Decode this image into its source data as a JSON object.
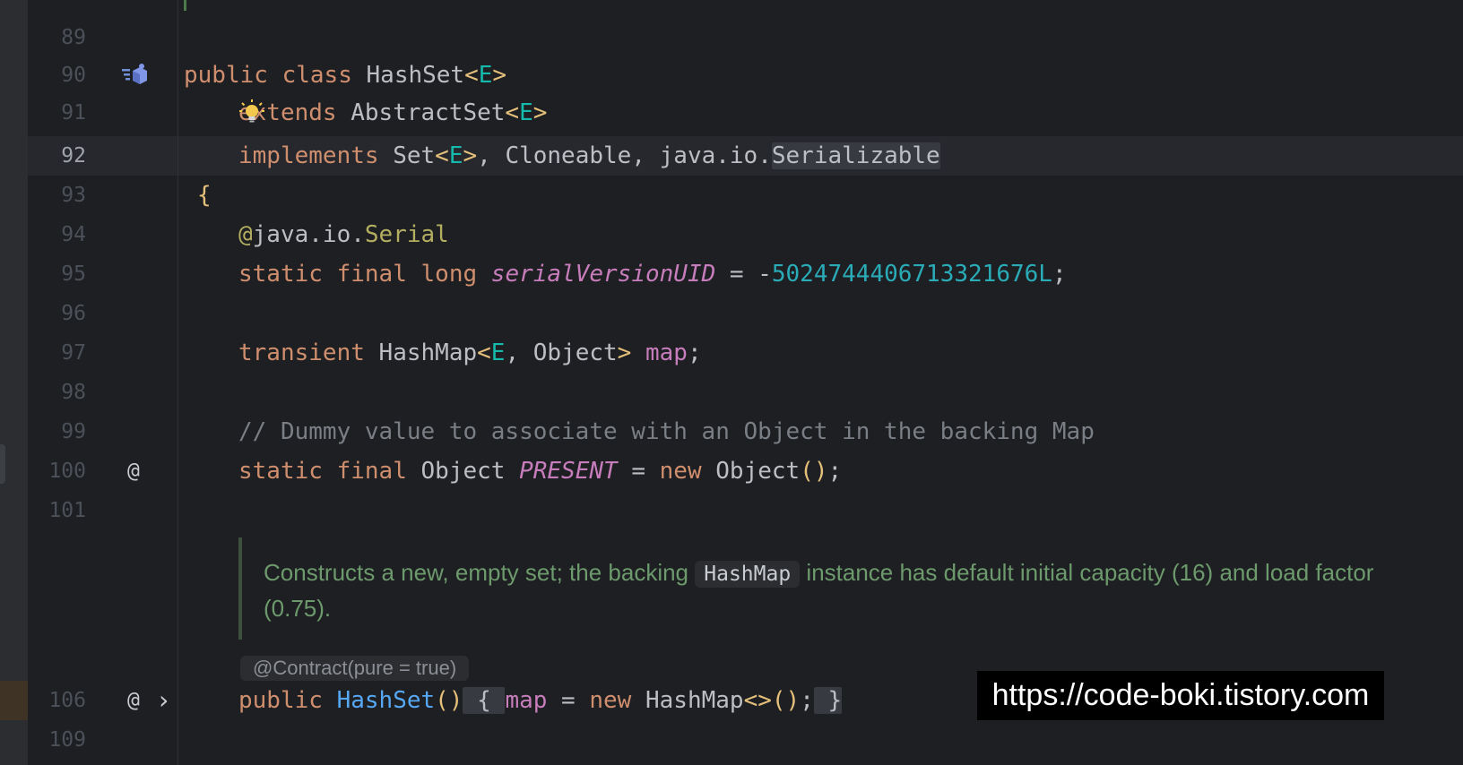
{
  "gutter": {
    "line_numbers": [
      "89",
      "90",
      "91",
      "92",
      "93",
      "94",
      "95",
      "96",
      "97",
      "98",
      "99",
      "100",
      "101",
      "106",
      "109"
    ],
    "override_marker": "@",
    "expand_marker": "›"
  },
  "code": {
    "l90": {
      "public": "public",
      "class": "class",
      "name": "HashSet",
      "lt": "<",
      "E": "E",
      "gt": ">"
    },
    "l91": {
      "extends": "extends",
      "name": "AbstractSet",
      "lt": "<",
      "E": "E",
      "gt": ">"
    },
    "l92": {
      "implements": "implements",
      "set": "Set",
      "lt": "<",
      "E": "E",
      "gt": ">",
      "rest": ", Cloneable, java.io.",
      "serializable": "Serializable"
    },
    "l93": {
      "brace": "{"
    },
    "l94": {
      "at": "@",
      "path": "java.io.",
      "serial": "Serial"
    },
    "l95": {
      "static": "static",
      "final": "final",
      "long": "long",
      "field": "serialVersionUID",
      "eq": " = -",
      "num": "5024744406713321676L",
      "semi": ";"
    },
    "l97": {
      "transient": "transient",
      "type": "HashMap",
      "lt": "<",
      "E": "E",
      "mid": ", Object",
      "gt": ">",
      "field": "map",
      "semi": ";"
    },
    "l99": {
      "comment": "// Dummy value to associate with an Object in the backing Map"
    },
    "l100": {
      "static": "static",
      "final": "final",
      "type": "Object",
      "field": "PRESENT",
      "eq": " = ",
      "new": "new",
      "ctor": "Object",
      "paren": "()",
      "semi": ";"
    },
    "l106": {
      "public": "public",
      "name": "HashSet",
      "paren": "()",
      "lbrace": "{",
      "field": "map",
      "eq": " = ",
      "new": "new",
      "type": "HashMap",
      "diamond": "<>",
      "paren2": "()",
      "semi": ";",
      "rbrace": "}"
    }
  },
  "doc": {
    "text_before": "Constructs a new, empty set; the backing ",
    "code": "HashMap",
    "text_after": " instance has default initial capacity (16) and load factor (0.75)."
  },
  "contract_hint": "@Contract(pure = true)",
  "watermark": "https://code-boki.tistory.com",
  "colors": {
    "background": "#1e1f22",
    "keyword": "#cf8e6d",
    "type_param": "#16baac",
    "field": "#c77dbb",
    "number": "#2aacb8",
    "annotation": "#b3ae60",
    "method": "#56a8f5",
    "doc_comment": "#6c9a6c"
  },
  "icons": [
    "implemented-by-icon",
    "intention-bulb-icon",
    "override-icon",
    "fold-expand-icon"
  ]
}
